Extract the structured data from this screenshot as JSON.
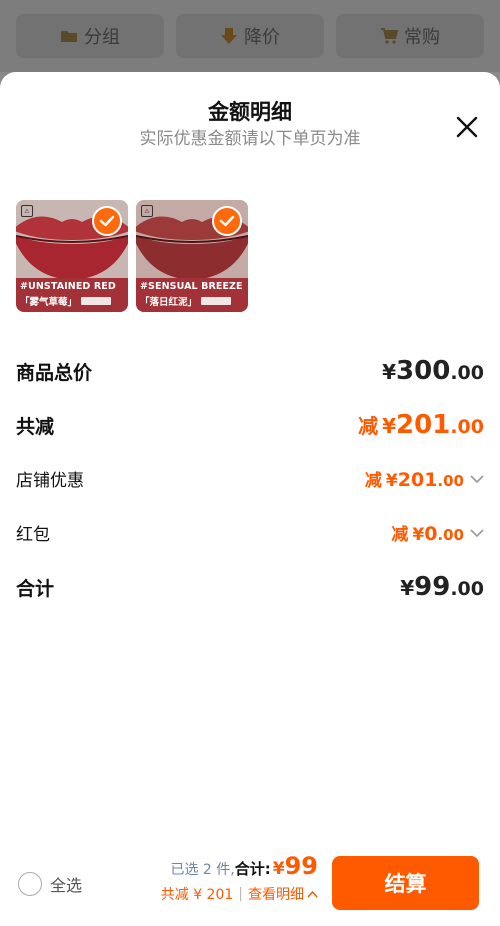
{
  "top_tabs": [
    {
      "label": "分组",
      "icon": "folder-icon"
    },
    {
      "label": "降价",
      "icon": "price-down-icon"
    },
    {
      "label": "常购",
      "icon": "cart-icon"
    }
  ],
  "sheet": {
    "title": "金额明细",
    "subtitle": "实际优惠金额请以下单页为准"
  },
  "products": [
    {
      "en": "#UNSTAINED RED",
      "cn": "「雾气草莓」",
      "selected": true
    },
    {
      "en": "#SENSUAL BREEZE",
      "cn": "「落日红泥」",
      "selected": true
    }
  ],
  "rows": {
    "goods_total": {
      "label": "商品总价",
      "yen": "¥",
      "int": "300",
      "dec": ".00"
    },
    "total_reduce": {
      "label": "共减",
      "prefix": "减",
      "yen": "¥",
      "int": "201",
      "dec": ".00"
    },
    "store_discount": {
      "label": "店铺优惠",
      "prefix": "减",
      "yen": "¥",
      "int": "201",
      "dec": ".00"
    },
    "red_packet": {
      "label": "红包",
      "prefix": "减",
      "yen": "¥",
      "int": "0",
      "dec": ".00"
    },
    "sum": {
      "label": "合计",
      "yen": "¥",
      "int": "99",
      "dec": ".00"
    }
  },
  "bottom": {
    "select_all": "全选",
    "selected_count": "已选 2 件,",
    "total_label": "合计:",
    "total_yen": "¥",
    "total_value": "99",
    "reduce_text": "共减 ¥ 201",
    "separator": "|",
    "detail_link": "查看明细",
    "checkout": "结算"
  },
  "colors": {
    "accent": "#ff5a00",
    "check": "#ff6a0c",
    "product_band": "#a23238"
  }
}
